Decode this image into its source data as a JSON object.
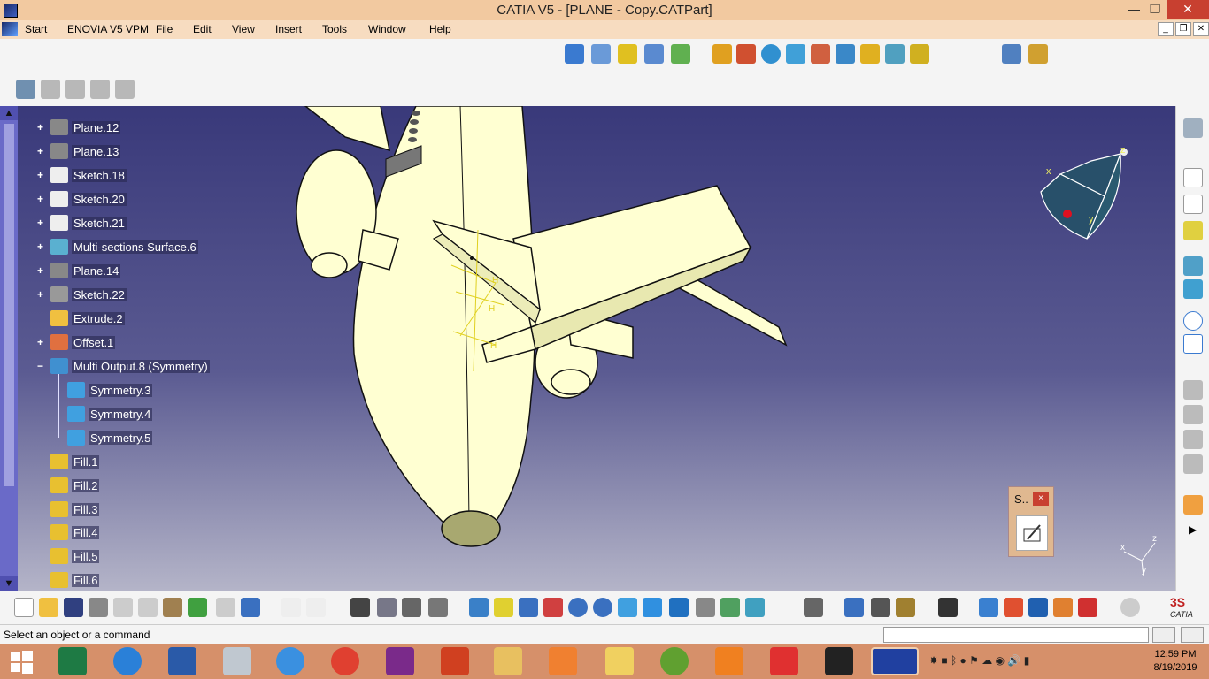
{
  "window": {
    "title": "CATIA V5 - [PLANE - Copy.CATPart]",
    "min": "—",
    "max": "❐",
    "close": "✕"
  },
  "menu": [
    "Start",
    "ENOVIA V5 VPM",
    "File",
    "Edit",
    "View",
    "Insert",
    "Tools",
    "Window",
    "Help"
  ],
  "tree": {
    "items": [
      {
        "label": "Plane.12",
        "icon": "plane-icon",
        "plus": "+"
      },
      {
        "label": "Plane.13",
        "icon": "plane-icon",
        "plus": "+"
      },
      {
        "label": "Sketch.18",
        "icon": "sketch-icon",
        "plus": "+"
      },
      {
        "label": "Sketch.20",
        "icon": "sketch-icon",
        "plus": "+"
      },
      {
        "label": "Sketch.21",
        "icon": "sketch-icon",
        "plus": "+"
      },
      {
        "label": "Multi-sections Surface.6",
        "icon": "multi-section-surface-icon",
        "plus": "+"
      },
      {
        "label": "Plane.14",
        "icon": "plane-icon",
        "plus": "+"
      },
      {
        "label": "Sketch.22",
        "icon": "sketch-icon",
        "plus": "+"
      },
      {
        "label": "Extrude.2",
        "icon": "extrude-icon",
        "plus": ""
      },
      {
        "label": "Offset.1",
        "icon": "offset-icon",
        "plus": "+"
      },
      {
        "label": "Multi Output.8 (Symmetry)",
        "icon": "multi-output-icon",
        "plus": "−"
      },
      {
        "label": "Symmetry.3",
        "icon": "symmetry-icon",
        "plus": ""
      },
      {
        "label": "Symmetry.4",
        "icon": "symmetry-icon",
        "plus": ""
      },
      {
        "label": "Symmetry.5",
        "icon": "symmetry-icon",
        "plus": ""
      },
      {
        "label": "Fill.1",
        "icon": "fill-icon",
        "plus": ""
      },
      {
        "label": "Fill.2",
        "icon": "fill-icon",
        "plus": ""
      },
      {
        "label": "Fill.3",
        "icon": "fill-icon",
        "plus": ""
      },
      {
        "label": "Fill.4",
        "icon": "fill-icon",
        "plus": ""
      },
      {
        "label": "Fill.5",
        "icon": "fill-icon",
        "plus": ""
      },
      {
        "label": "Fill.6",
        "icon": "fill-icon",
        "plus": ""
      }
    ]
  },
  "status": {
    "message": "Select an object or a command"
  },
  "sketch_toolbar": {
    "label": "S..",
    "close": "×"
  },
  "axis": {
    "x": "x",
    "y": "y",
    "z": "z"
  },
  "clock": {
    "time": "12:59 PM",
    "date": "8/19/2019"
  },
  "colors": {
    "viewport_top": "#39397a",
    "model": "#ffffd2",
    "taskbar": "#d6906a"
  }
}
